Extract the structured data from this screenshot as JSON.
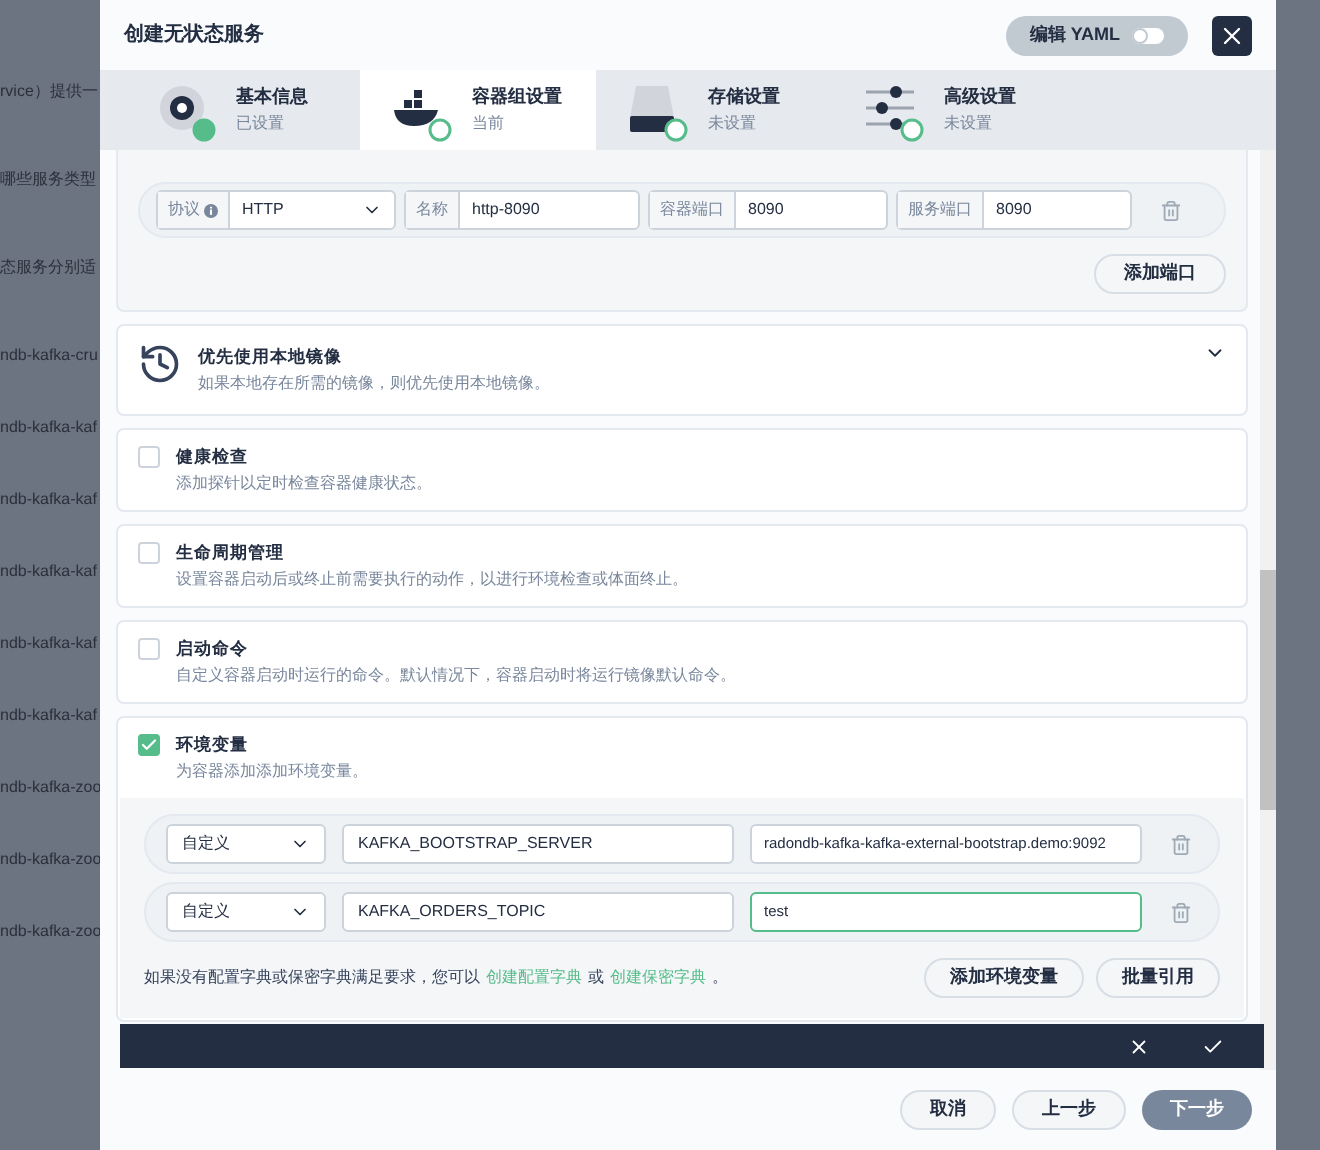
{
  "background": {
    "items": [
      "rvice）提供一",
      "哪些服务类型",
      "态服务分别适",
      "ndb-kafka-cru",
      "ndb-kafka-kaf",
      "ndb-kafka-kaf",
      "ndb-kafka-kaf",
      "ndb-kafka-kaf",
      "ndb-kafka-kaf",
      "ndb-kafka-zoo",
      "ndb-kafka-zoo",
      "ndb-kafka-zoo"
    ]
  },
  "window": {
    "title": "创建无状态服务",
    "yaml_toggle": {
      "label": "编辑 YAML",
      "on": false
    }
  },
  "steps": [
    {
      "kind": "info",
      "title": "基本信息",
      "status": "已设置",
      "selected": false,
      "done": true
    },
    {
      "kind": "container",
      "title": "容器组设置",
      "status": "当前",
      "selected": true,
      "done": false
    },
    {
      "kind": "storage",
      "title": "存储设置",
      "status": "未设置",
      "selected": false,
      "done": false
    },
    {
      "kind": "advanced",
      "title": "高级设置",
      "status": "未设置",
      "selected": false,
      "done": false
    }
  ],
  "port": {
    "protocol_label": "协议",
    "protocol": "HTTP",
    "name_label": "名称",
    "name": "http-8090",
    "container_port_label": "容器端口",
    "container_port": "8090",
    "service_port_label": "服务端口",
    "service_port": "8090",
    "add_button": "添加端口"
  },
  "sections": [
    {
      "kind": "expand",
      "title": "优先使用本地镜像",
      "description": "如果本地存在所需的镜像，则优先使用本地镜像。",
      "expanded": false
    },
    {
      "kind": "check",
      "title": "健康检查",
      "description": "添加探针以定时检查容器健康状态。",
      "checked": false
    },
    {
      "kind": "check",
      "title": "生命周期管理",
      "description": "设置容器启动后或终止前需要执行的动作，以进行环境检查或体面终止。",
      "checked": false
    },
    {
      "kind": "check",
      "title": "启动命令",
      "description": "自定义容器启动时运行的命令。默认情况下，容器启动时将运行镜像默认命令。",
      "checked": false
    },
    {
      "kind": "check",
      "title": "环境变量",
      "description": "为容器添加添加环境变量。",
      "checked": true
    }
  ],
  "env": {
    "rows": [
      {
        "type": "自定义",
        "key": "KAFKA_BOOTSTRAP_SERVER",
        "value": "radondb-kafka-kafka-external-bootstrap.demo:9092",
        "focused": false
      },
      {
        "type": "自定义",
        "key": "KAFKA_ORDERS_TOPIC",
        "value": "test",
        "focused": true
      }
    ],
    "hint": "如果没有配置字典或保密字典满足要求，您可以",
    "link_1": "创建配置字典",
    "or": "或",
    "link_2": "创建保密字典",
    "hint_end": "。",
    "add_button": "添加环境变量",
    "batch_button": "批量引用"
  },
  "footer": {
    "buttons": [
      {
        "label": "取消",
        "kind": "default"
      },
      {
        "label": "上一步",
        "kind": "default"
      },
      {
        "label": "下一步",
        "kind": "primary"
      }
    ]
  }
}
